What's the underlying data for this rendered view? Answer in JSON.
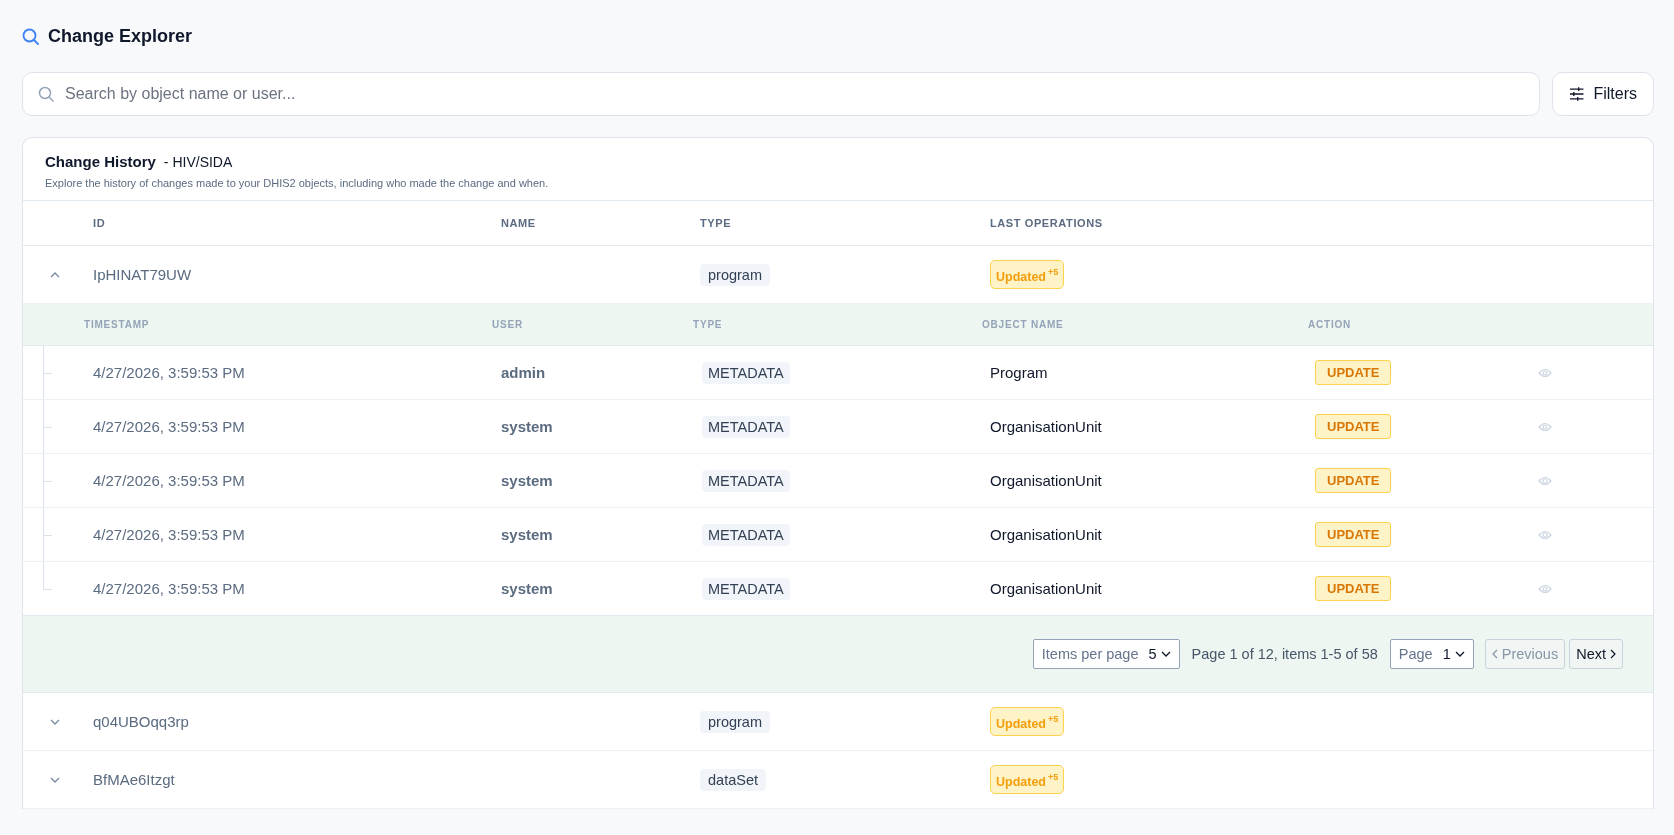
{
  "header": {
    "title": "Change Explorer"
  },
  "search": {
    "placeholder": "Search by object name or user..."
  },
  "filters_button": {
    "label": "Filters"
  },
  "card": {
    "title": "Change History",
    "subtitle": "- HIV/SIDA",
    "description": "Explore the history of changes made to your DHIS2 objects, including who made the change and when."
  },
  "table": {
    "columns": [
      "ID",
      "NAME",
      "TYPE",
      "LAST OPERATIONS"
    ],
    "rows": [
      {
        "id": "IpHINAT79UW",
        "type": "program",
        "operation": "Updated",
        "operation_count": "+5",
        "expanded": true,
        "history": {
          "columns": [
            "TIMESTAMP",
            "USER",
            "TYPE",
            "OBJECT NAME",
            "ACTION"
          ],
          "rows": [
            {
              "timestamp": "4/27/2026, 3:59:53 PM",
              "user": "admin",
              "type": "METADATA",
              "object_name": "Program",
              "action": "UPDATE"
            },
            {
              "timestamp": "4/27/2026, 3:59:53 PM",
              "user": "system",
              "type": "METADATA",
              "object_name": "OrganisationUnit",
              "action": "UPDATE"
            },
            {
              "timestamp": "4/27/2026, 3:59:53 PM",
              "user": "system",
              "type": "METADATA",
              "object_name": "OrganisationUnit",
              "action": "UPDATE"
            },
            {
              "timestamp": "4/27/2026, 3:59:53 PM",
              "user": "system",
              "type": "METADATA",
              "object_name": "OrganisationUnit",
              "action": "UPDATE"
            },
            {
              "timestamp": "4/27/2026, 3:59:53 PM",
              "user": "system",
              "type": "METADATA",
              "object_name": "OrganisationUnit",
              "action": "UPDATE"
            }
          ],
          "pagination": {
            "items_per_page_label": "Items per page",
            "items_per_page": "5",
            "summary": "Page 1 of 12, items 1-5 of 58",
            "page_label": "Page",
            "page": "1",
            "previous": {
              "label": "Previous",
              "disabled": true
            },
            "next": {
              "label": "Next",
              "disabled": false
            }
          }
        }
      },
      {
        "id": "q04UBOqq3rp",
        "type": "program",
        "operation": "Updated",
        "operation_count": "+5",
        "expanded": false
      },
      {
        "id": "BfMAe6Itzgt",
        "type": "dataSet",
        "operation": "Updated",
        "operation_count": "+5",
        "expanded": false
      }
    ]
  }
}
